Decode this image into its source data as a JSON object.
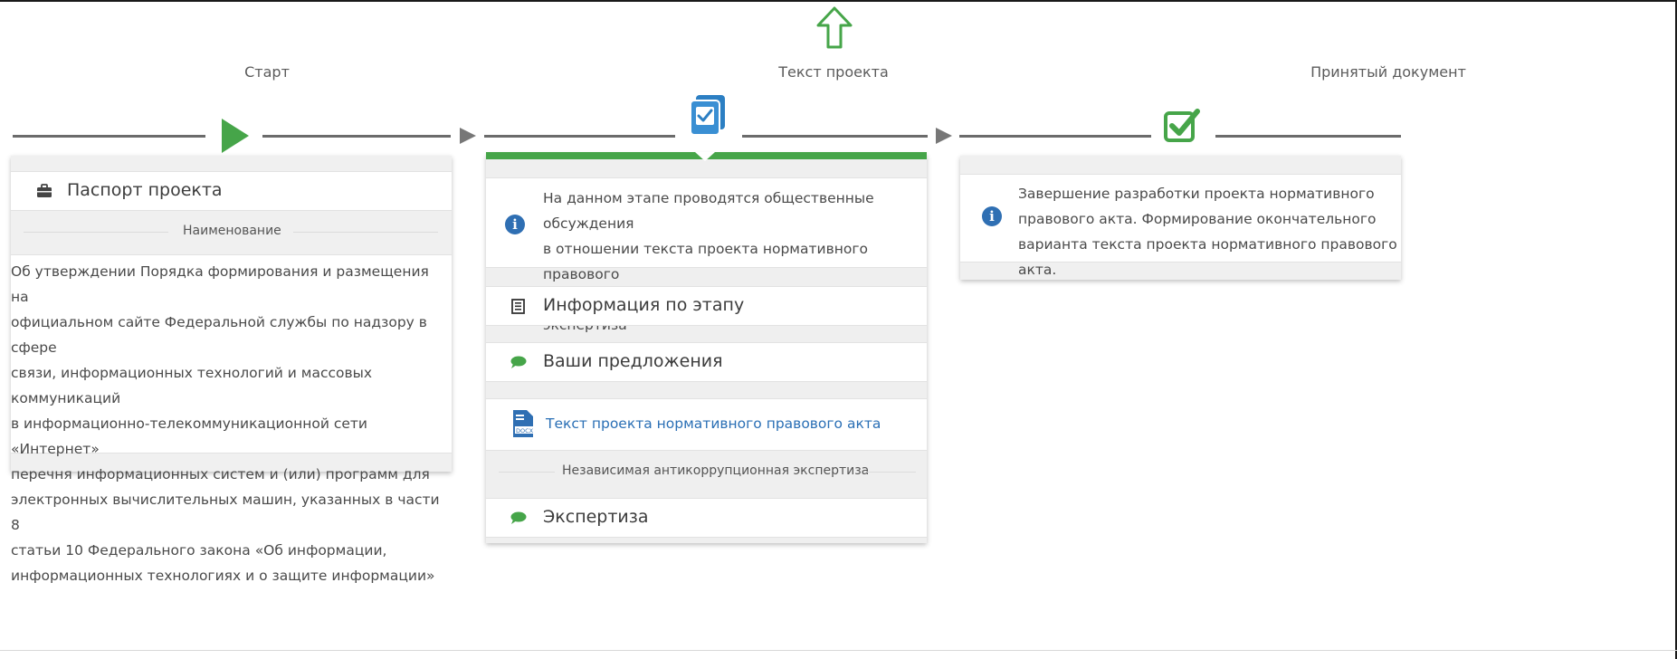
{
  "stages": {
    "start": {
      "title": "Старт"
    },
    "text": {
      "title": "Текст проекта"
    },
    "accepted": {
      "title": "Принятый документ"
    }
  },
  "passport": {
    "header": "Паспорт проекта",
    "name_label": "Наименование",
    "name_text": "Об утверждении Порядка формирования и размещения на\nофициальном сайте Федеральной службы по надзору в сфере\nсвязи, информационных технологий и массовых коммуникаций\nв информационно-телекоммуникационной сети «Интернет»\nперечня информационных систем и (или) программ для\nэлектронных вычислительных машин, указанных в части 8\nстатьи 10 Федерального закона «Об информации,\nинформационных технологиях и о защите информации»"
  },
  "text_stage": {
    "info": "На данном этапе проводятся общественные обсуждения\nв отношении текста проекта нормативного правового\nакта и независимая антикоррупционная экспертиза",
    "stage_info": "Информация по этапу",
    "proposals": "Ваши предложения",
    "doc_link": "Текст проекта нормативного правового акта",
    "doc_icon_label": "DOCX",
    "anti_corruption_label": "Независимая антикоррупционная экспертиза",
    "expertise": "Экспертиза"
  },
  "accepted_stage": {
    "info": "Завершение разработки проекта нормативного\nправового акта. Формирование окончательного\nварианта текста проекта нормативного правового акта."
  },
  "colors": {
    "green": "#46a549",
    "blue": "#2f6fb3",
    "link": "#2a6fb5"
  },
  "icons": [
    "up-arrow-icon",
    "play-icon",
    "document-check-icon",
    "checkbox-checked-icon",
    "briefcase-icon",
    "info-icon",
    "list-icon",
    "comment-icon",
    "docx-file-icon"
  ]
}
